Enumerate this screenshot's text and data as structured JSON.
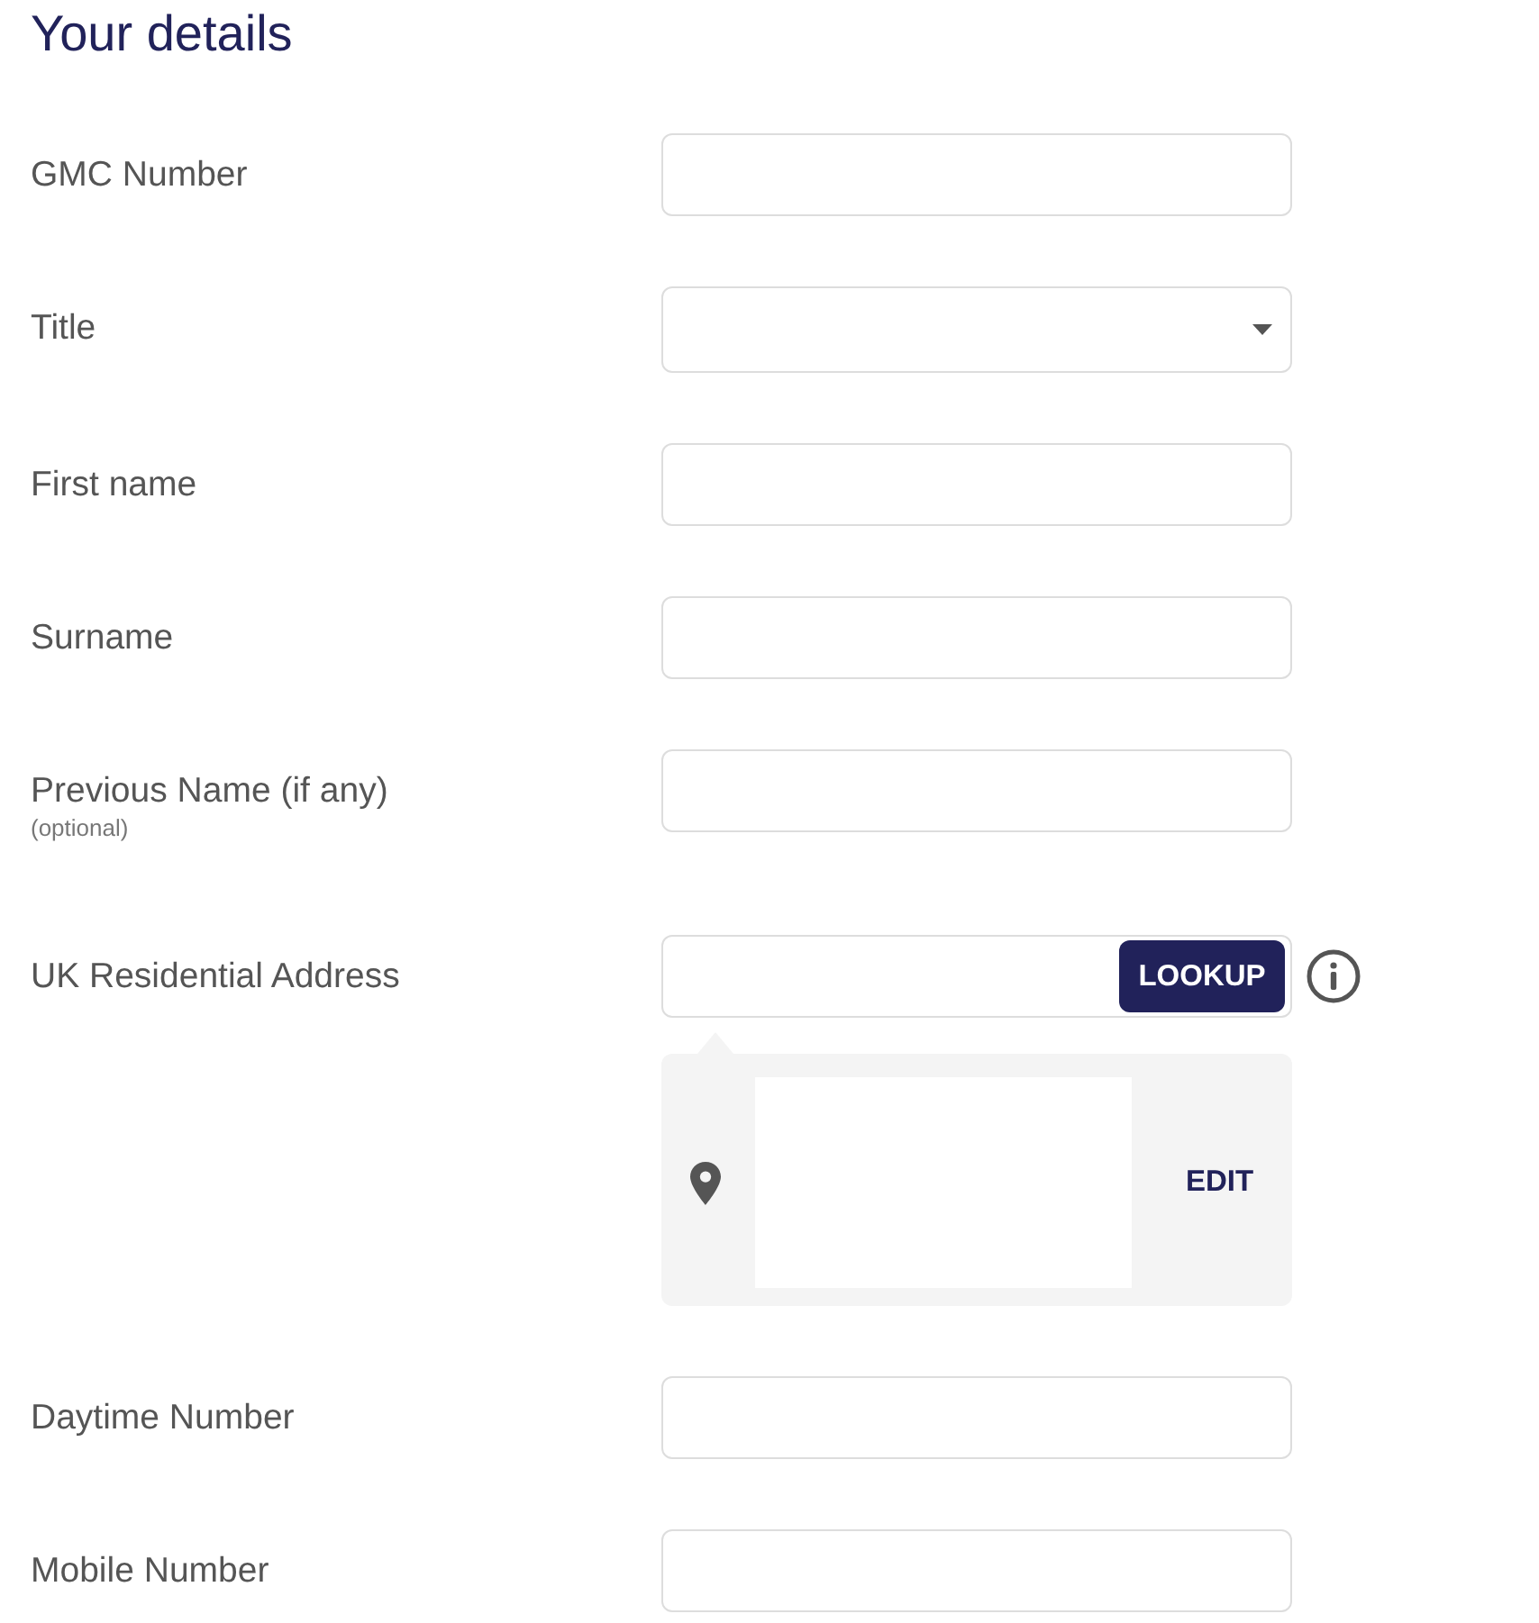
{
  "heading": "Your details",
  "fields": [
    {
      "kind": "text",
      "label": "GMC Number"
    },
    {
      "kind": "select",
      "label": "Title"
    },
    {
      "kind": "text",
      "label": "First name"
    },
    {
      "kind": "text",
      "label": "Surname"
    },
    {
      "kind": "text",
      "label": "Previous Name (if any)",
      "note": "(optional)"
    },
    {
      "kind": "address",
      "label": "UK Residential Address",
      "button": "LOOKUP",
      "action": "EDIT"
    },
    {
      "kind": "text",
      "label": "Daytime Number"
    },
    {
      "kind": "text",
      "label": "Mobile Number"
    }
  ]
}
